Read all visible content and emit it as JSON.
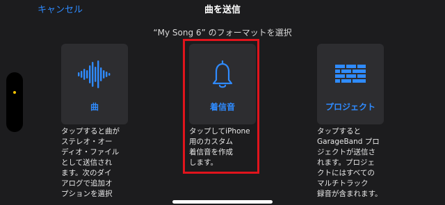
{
  "nav": {
    "cancel_label": "キャンセル",
    "title": "曲を送信"
  },
  "subtitle": "“My Song 6” のフォーマットを選択",
  "options": [
    {
      "icon": "waveform-icon",
      "label": "曲",
      "description": "タップすると曲が\nステレオ・オー\nディオ・ファイル\nとして送信され\nます。次のダイ\nアログで追加オ\nプションを選択"
    },
    {
      "icon": "bell-icon",
      "label": "着信音",
      "description": "タップしてiPhone\n用のカスタム\n着信音を作成\nします。"
    },
    {
      "icon": "bricks-icon",
      "label": "プロジェクト",
      "description": "タップすると\nGarageBand プロ\nジェクトが送信さ\nれます。プロジェ\nクトにはすべての\nマルチトラック\n録音が含まれます。"
    }
  ],
  "colors": {
    "accent": "#2f8bff",
    "highlight": "#e0141c",
    "background": "#1c1c1e",
    "tile": "#2d2d30"
  }
}
